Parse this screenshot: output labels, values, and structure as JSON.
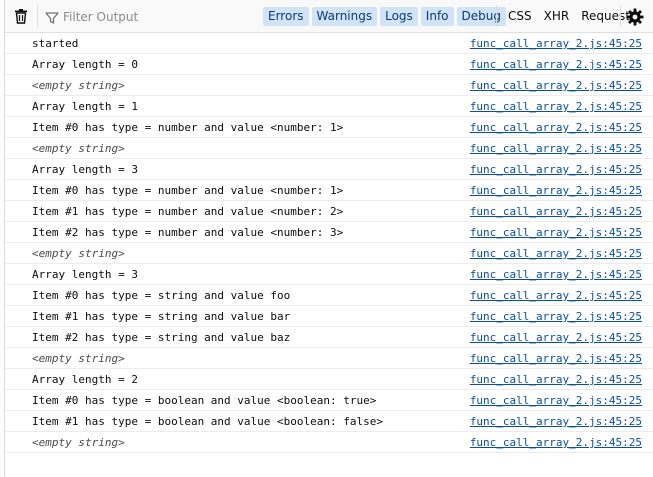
{
  "toolbar": {
    "trash_icon": "trash-icon",
    "filter_icon": "funnel-icon",
    "filter_placeholder": "Filter Output",
    "filter_value": "",
    "level_filters": [
      {
        "label": "Errors",
        "active": true
      },
      {
        "label": "Warnings",
        "active": true
      },
      {
        "label": "Logs",
        "active": true
      },
      {
        "label": "Info",
        "active": true
      },
      {
        "label": "Debug",
        "active": true
      }
    ],
    "type_filters": [
      {
        "label": "CSS",
        "active": false
      },
      {
        "label": "XHR",
        "active": false
      },
      {
        "label": "Requests",
        "active": false
      }
    ],
    "settings_icon": "gear-icon",
    "accent_color": "#d1e3f7"
  },
  "log": [
    {
      "message": "started",
      "empty": false,
      "source": "func_call_array_2.js:45:25"
    },
    {
      "message": "Array length = 0",
      "empty": false,
      "source": "func_call_array_2.js:45:25"
    },
    {
      "message": "<empty string>",
      "empty": true,
      "source": "func_call_array_2.js:45:25"
    },
    {
      "message": "Array length = 1",
      "empty": false,
      "source": "func_call_array_2.js:45:25"
    },
    {
      "message": "Item #0 has type = number and value <number: 1>",
      "empty": false,
      "source": "func_call_array_2.js:45:25"
    },
    {
      "message": "<empty string>",
      "empty": true,
      "source": "func_call_array_2.js:45:25"
    },
    {
      "message": "Array length = 3",
      "empty": false,
      "source": "func_call_array_2.js:45:25"
    },
    {
      "message": "Item #0 has type = number and value <number: 1>",
      "empty": false,
      "source": "func_call_array_2.js:45:25"
    },
    {
      "message": "Item #1 has type = number and value <number: 2>",
      "empty": false,
      "source": "func_call_array_2.js:45:25"
    },
    {
      "message": "Item #2 has type = number and value <number: 3>",
      "empty": false,
      "source": "func_call_array_2.js:45:25"
    },
    {
      "message": "<empty string>",
      "empty": true,
      "source": "func_call_array_2.js:45:25"
    },
    {
      "message": "Array length = 3",
      "empty": false,
      "source": "func_call_array_2.js:45:25"
    },
    {
      "message": "Item #0 has type = string and value foo",
      "empty": false,
      "source": "func_call_array_2.js:45:25"
    },
    {
      "message": "Item #1 has type = string and value bar",
      "empty": false,
      "source": "func_call_array_2.js:45:25"
    },
    {
      "message": "Item #2 has type = string and value baz",
      "empty": false,
      "source": "func_call_array_2.js:45:25"
    },
    {
      "message": "<empty string>",
      "empty": true,
      "source": "func_call_array_2.js:45:25"
    },
    {
      "message": "Array length = 2",
      "empty": false,
      "source": "func_call_array_2.js:45:25"
    },
    {
      "message": "Item #0 has type = boolean and value <boolean: true>",
      "empty": false,
      "source": "func_call_array_2.js:45:25"
    },
    {
      "message": "Item #1 has type = boolean and value <boolean: false>",
      "empty": false,
      "source": "func_call_array_2.js:45:25"
    },
    {
      "message": "<empty string>",
      "empty": true,
      "source": "func_call_array_2.js:45:25"
    }
  ]
}
